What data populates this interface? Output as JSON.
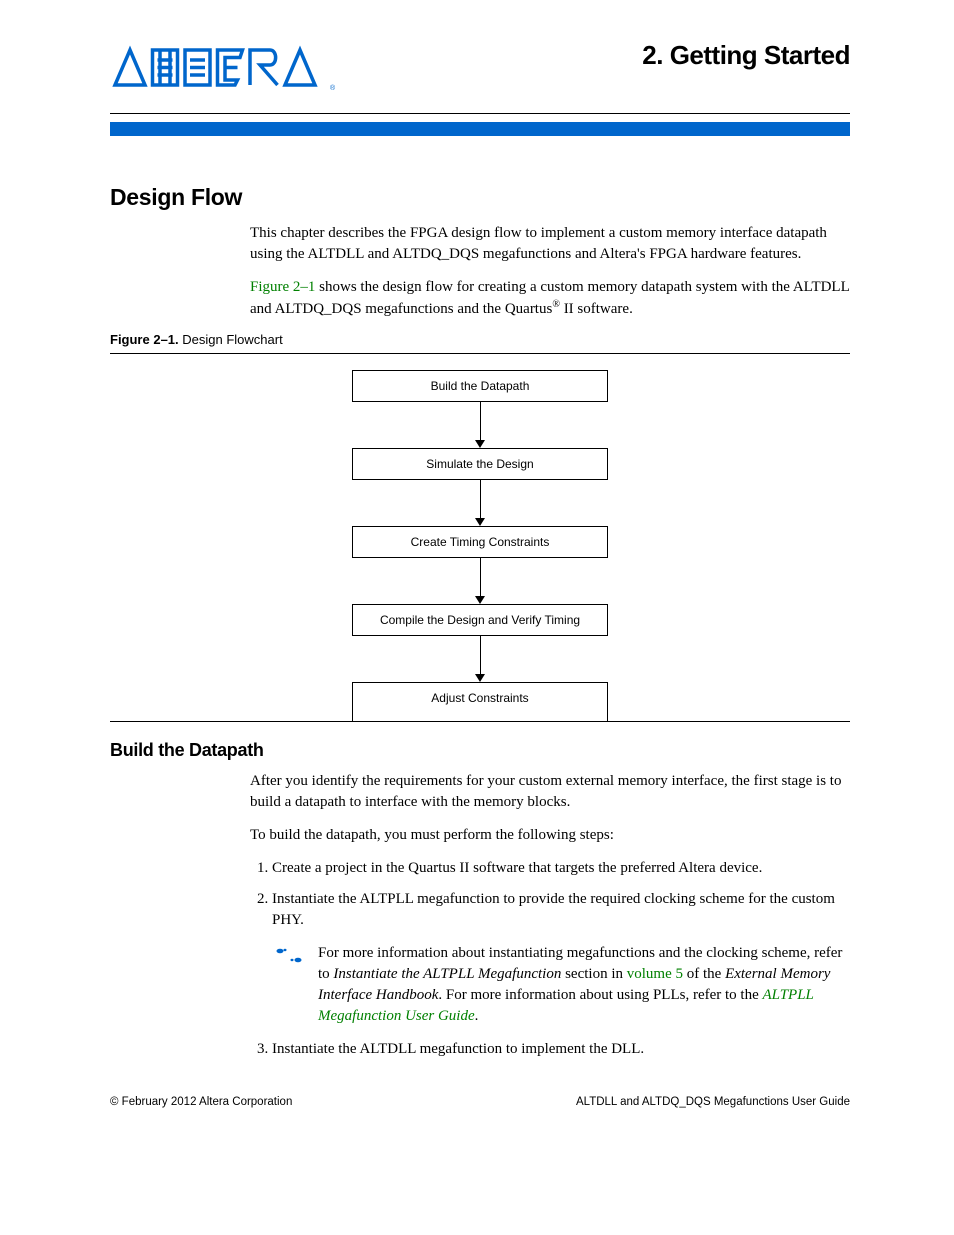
{
  "header": {
    "chapter_title": "2.  Getting Started",
    "logo_alt": "Altera"
  },
  "section1": {
    "title": "Design Flow",
    "p1_a": "This chapter describes the FPGA design flow to implement a custom memory interface datapath using the ALTDLL and ALTDQ_DQS megafunctions and Altera's FPGA hardware features.",
    "p2_link": "Figure 2–1",
    "p2_a": " shows the design flow for creating a custom memory datapath system with the ALTDLL and ALTDQ_DQS megafunctions and the Quartus",
    "p2_sup": "®",
    "p2_b": " II software."
  },
  "figure": {
    "caption_bold": "Figure 2–1.",
    "caption_rest": "Design Flowchart",
    "steps": [
      "Build the Datapath",
      "Simulate the Design",
      "Create Timing Constraints",
      "Compile the Design and Verify Timing",
      "Adjust Constraints"
    ]
  },
  "section2": {
    "title": "Build the Datapath",
    "p1": "After you identify the requirements for your custom external memory interface, the first stage is to build a datapath to interface with the memory blocks.",
    "p2": "To build the datapath, you must perform the following steps:",
    "li1": "Create a project in the Quartus II software that targets the preferred Altera device.",
    "li2": "Instantiate the ALTPLL megafunction to provide the required clocking scheme for the custom PHY.",
    "note_a": "For more information about instantiating megafunctions and the clocking scheme, refer to ",
    "note_i1": "Instantiate the ALTPLL Megafunction",
    "note_b": " section in ",
    "note_link1": "volume 5",
    "note_c": " of the ",
    "note_i2": "External Memory Interface Handbook",
    "note_d": ". For more information about using PLLs, refer to the ",
    "note_link2": "ALTPLL Megafunction User Guide",
    "note_e": ".",
    "li3": "Instantiate the ALTDLL megafunction to implement the DLL."
  },
  "footer": {
    "left": "© February 2012   Altera Corporation",
    "right": "ALTDLL and ALTDQ_DQS Megafunctions User Guide"
  },
  "colors": {
    "brand_blue": "#0066cc",
    "link_green": "#008000"
  }
}
